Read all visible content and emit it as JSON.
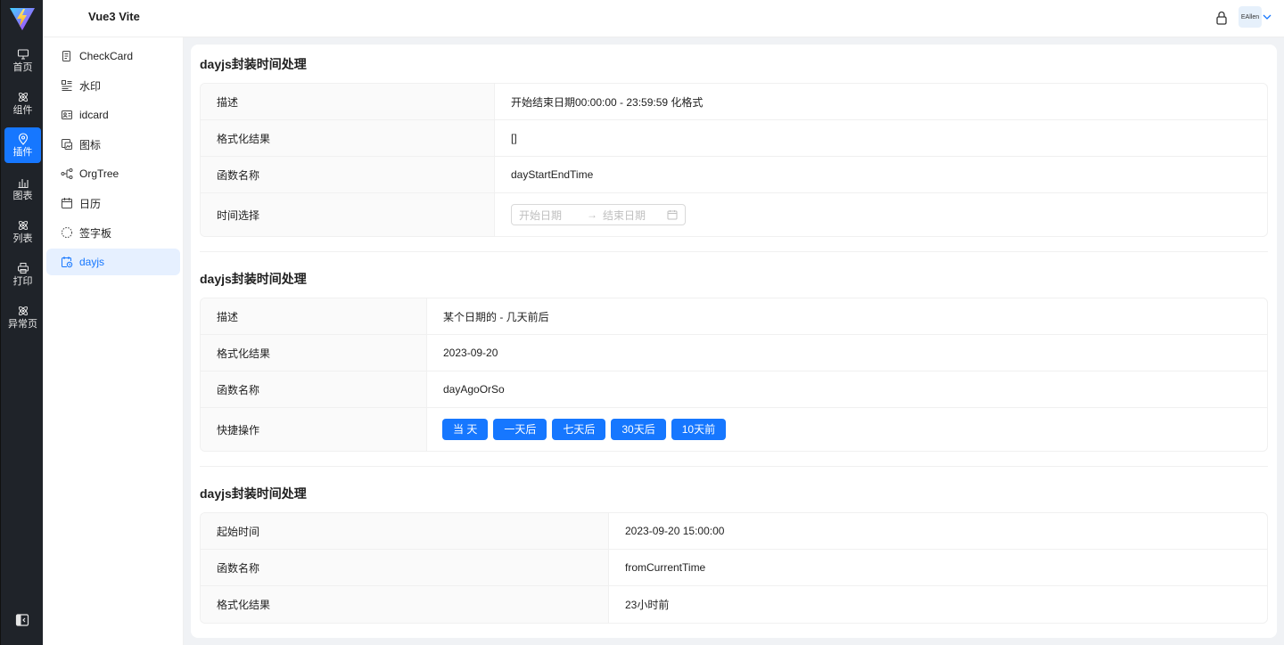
{
  "app": {
    "title": "Vue3 Vite"
  },
  "header": {
    "avatar_text": "EAllen"
  },
  "rail": {
    "items": [
      {
        "label": "首页",
        "icon": "monitor-icon"
      },
      {
        "label": "组件",
        "icon": "atom-icon"
      },
      {
        "label": "插件",
        "icon": "location-pin-icon"
      },
      {
        "label": "图表",
        "icon": "bar-chart-icon"
      },
      {
        "label": "列表",
        "icon": "atom-icon"
      },
      {
        "label": "打印",
        "icon": "printer-icon"
      },
      {
        "label": "异常页",
        "icon": "atom-icon"
      }
    ],
    "active_index": 2
  },
  "submenu": {
    "items": [
      {
        "label": "CheckCard",
        "icon": "document-icon"
      },
      {
        "label": "水印",
        "icon": "watermark-icon"
      },
      {
        "label": "idcard",
        "icon": "idcard-icon"
      },
      {
        "label": "图标",
        "icon": "image-icon"
      },
      {
        "label": "OrgTree",
        "icon": "tree-icon"
      },
      {
        "label": "日历",
        "icon": "calendar-icon"
      },
      {
        "label": "签字板",
        "icon": "signature-icon"
      },
      {
        "label": "dayjs",
        "icon": "clock-calendar-icon"
      }
    ],
    "active_index": 7
  },
  "sections": [
    {
      "title": "dayjs封装时间处理",
      "rows": [
        {
          "key": "描述",
          "value": "开始结束日期00:00:00 - 23:59:59 化格式"
        },
        {
          "key": "格式化结果",
          "value": "[]"
        },
        {
          "key": "函数名称",
          "value": "dayStartEndTime"
        },
        {
          "key": "时间选择",
          "value": ""
        }
      ],
      "range_picker": {
        "start_placeholder": "开始日期",
        "end_placeholder": "结束日期",
        "arrow": "→"
      }
    },
    {
      "title": "dayjs封装时间处理",
      "rows": [
        {
          "key": "描述",
          "value": "某个日期的 - 几天前后"
        },
        {
          "key": "格式化结果",
          "value": "2023-09-20"
        },
        {
          "key": "函数名称",
          "value": "dayAgoOrSo"
        },
        {
          "key": "快捷操作",
          "value": ""
        }
      ],
      "buttons": [
        "当 天",
        "一天后",
        "七天后",
        "30天后",
        "10天前"
      ]
    },
    {
      "title": "dayjs封装时间处理",
      "rows": [
        {
          "key": "起始时间",
          "value": "2023-09-20 15:00:00"
        },
        {
          "key": "函数名称",
          "value": "fromCurrentTime"
        },
        {
          "key": "格式化结果",
          "value": "23小时前"
        }
      ]
    }
  ],
  "colors": {
    "primary": "#1677ff",
    "rail_bg": "#1f2329",
    "page_bg": "#f0f2f5",
    "active_submenu_bg": "#e6f0ff"
  }
}
